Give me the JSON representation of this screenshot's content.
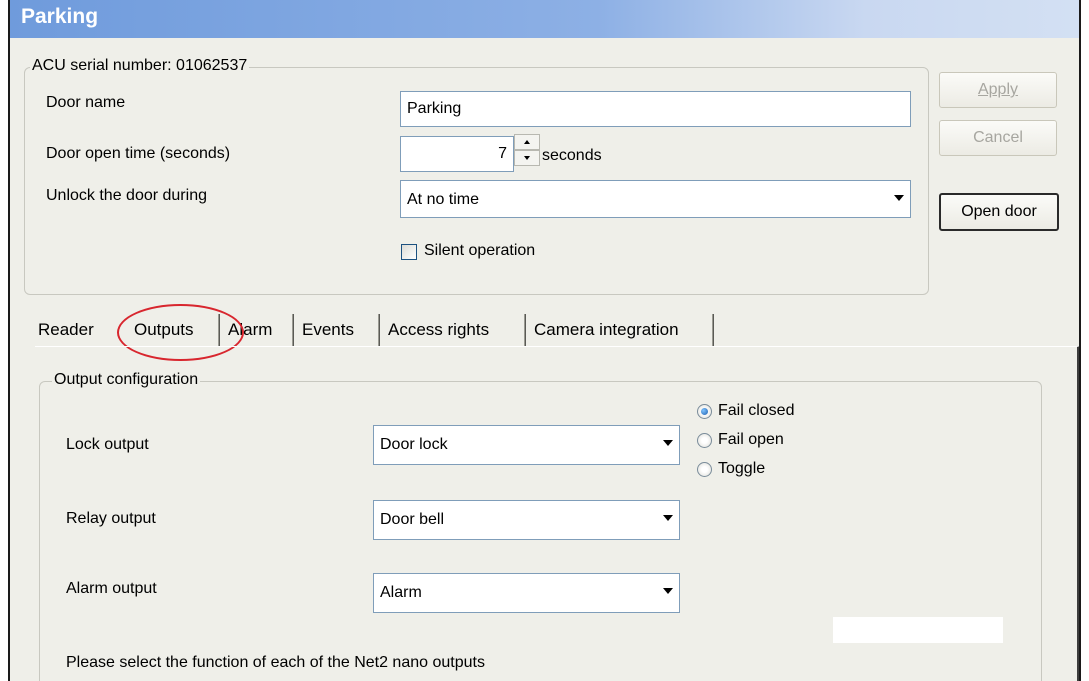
{
  "window": {
    "title": "Parking"
  },
  "acu_group": {
    "legend": "ACU serial number: 01062537",
    "door_name": {
      "label": "Door name",
      "value": "Parking"
    },
    "door_open_time": {
      "label": "Door open time (seconds)",
      "value": "7",
      "unit": "seconds"
    },
    "unlock_during": {
      "label": "Unlock the door during",
      "selected": "At no time"
    },
    "silent_operation": {
      "label": "Silent operation",
      "checked": false
    }
  },
  "buttons": {
    "apply": "Apply",
    "cancel": "Cancel",
    "open_door": "Open door"
  },
  "tabs": [
    {
      "label": "Reader",
      "active": false
    },
    {
      "label": "Outputs",
      "active": true
    },
    {
      "label": "Alarm",
      "active": false
    },
    {
      "label": "Events",
      "active": false
    },
    {
      "label": "Access rights",
      "active": false
    },
    {
      "label": "Camera integration",
      "active": false
    }
  ],
  "output_config": {
    "legend": "Output configuration",
    "lock_output": {
      "label": "Lock output",
      "selected": "Door lock"
    },
    "relay_output": {
      "label": "Relay output",
      "selected": "Door bell"
    },
    "alarm_output": {
      "label": "Alarm output",
      "selected": "Alarm"
    },
    "fail_mode": {
      "options": [
        "Fail closed",
        "Fail open",
        "Toggle"
      ],
      "selected": "Fail closed"
    },
    "help_text": "Please select the function of each of the Net2 nano outputs"
  },
  "colors": {
    "titlebar_start": "#6f9bdc",
    "titlebar_end": "#d3e0f3",
    "window_bg": "#efefe9",
    "highlight": "#d8262e"
  }
}
